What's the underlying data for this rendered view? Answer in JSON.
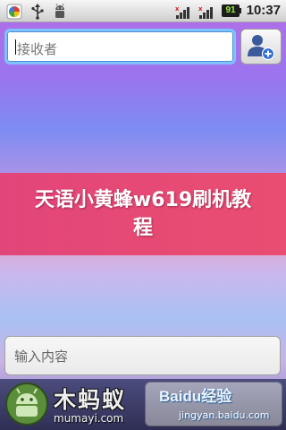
{
  "status_bar": {
    "time": "10:37",
    "battery_level": "91",
    "icons": [
      "app-icon",
      "usb-icon",
      "android-debug-icon",
      "signal-icon",
      "signal-icon",
      "battery-icon"
    ]
  },
  "compose": {
    "recipient_placeholder": "接收者",
    "message_placeholder": "输入内容",
    "contact_button_icon": "add-contact-icon"
  },
  "banner": {
    "title": "天语小黄蜂w619刷机教程",
    "background": "#e64a74"
  },
  "watermarks": {
    "left_brand": "木蚂蚁",
    "left_url": "mumayi.com",
    "right_brand": "Baidu经验",
    "right_url": "jingyan.baidu.com"
  },
  "colors": {
    "focus_border": "#7fc2ff",
    "battery_text": "#9ef03a"
  }
}
